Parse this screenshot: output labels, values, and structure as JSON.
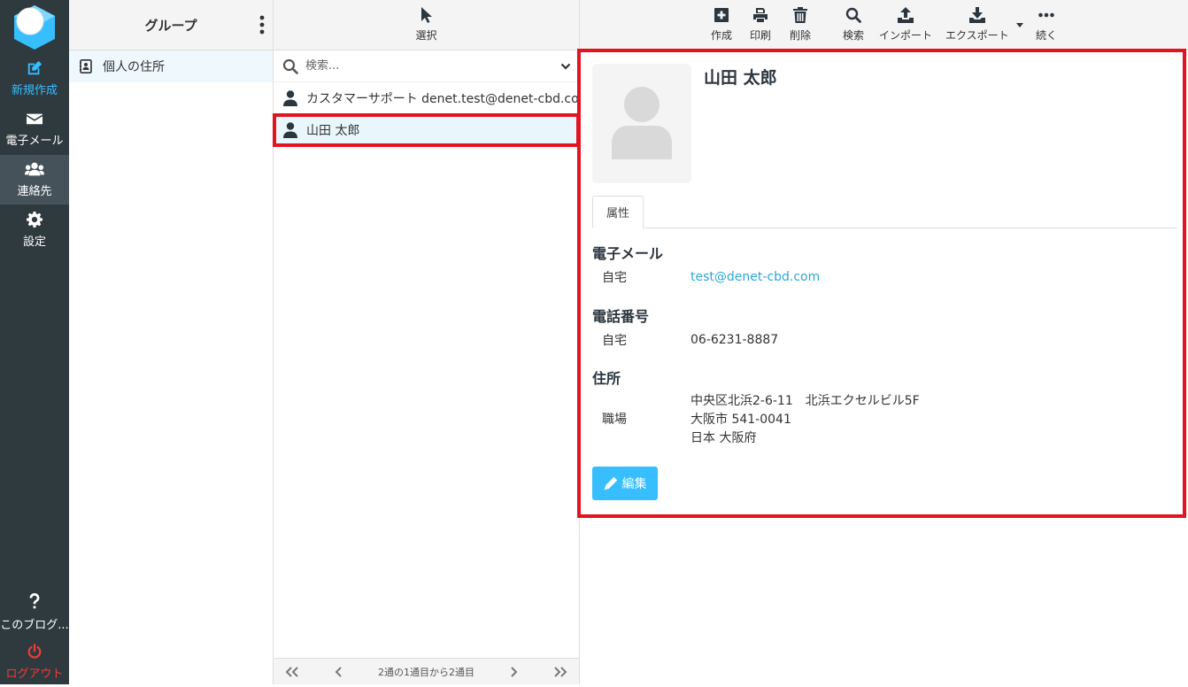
{
  "nav": {
    "compose": "新規作成",
    "mail": "電子メール",
    "contacts": "連絡先",
    "settings": "設定",
    "about": "このブログ...",
    "logout": "ログアウト"
  },
  "groups": {
    "title": "グループ",
    "items": [
      {
        "label": "個人の住所"
      }
    ]
  },
  "list": {
    "select_label": "選択",
    "search_placeholder": "検索...",
    "contacts": [
      {
        "label": "カスタマーサポート denet.test@denet-cbd.com"
      },
      {
        "label": "山田 太郎"
      }
    ],
    "pager_text": "2通の1通目から2通目"
  },
  "toolbar": {
    "create": "作成",
    "print": "印刷",
    "delete": "削除",
    "search": "検索",
    "import": "インポート",
    "export": "エクスポート",
    "more": "続く"
  },
  "detail": {
    "name": "山田 太郎",
    "tab": "属性",
    "email_section": "電子メール",
    "email_label": "自宅",
    "email_value": "test@denet-cbd.com",
    "phone_section": "電話番号",
    "phone_label": "自宅",
    "phone_value": "06-6231-8887",
    "address_section": "住所",
    "address_label": "職場",
    "address_line1": "中央区北浜2-6-11　北浜エクセルビル5F",
    "address_line2": "大阪市 541-0041",
    "address_line3": "日本 大阪府",
    "edit_label": "編集"
  },
  "colors": {
    "accent": "#37beff",
    "highlight_border": "#e2141f",
    "nav_bg": "#2f3a3f",
    "logout": "#f23b3b"
  }
}
